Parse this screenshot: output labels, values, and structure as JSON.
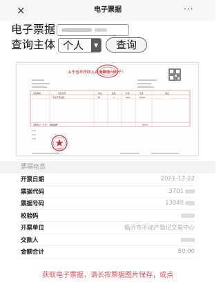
{
  "nav": {
    "close": "×",
    "title": "电子票据",
    "more": "···"
  },
  "query": {
    "receipt_label": "电子票据",
    "subject_label": "查询主体",
    "subject_value": "个人",
    "button_label": "查询"
  },
  "document": {
    "header_title": "山东省非税收入通用票据（电子）",
    "seal_text": "财政部门监制章",
    "issuer_seal_text": "专用章",
    "table_headers": [
      "项目编码",
      "项目名称",
      "单位",
      "数量",
      "标准",
      "金额",
      "备注"
    ],
    "table_row": [
      "",
      "不动产登记费",
      "件",
      "1",
      "80.0",
      "80.00",
      ""
    ],
    "total_label": "金额合计（大写）",
    "total_text": "捌拾圆整",
    "total_amount": "80.00"
  },
  "info": {
    "section_title": "票据信息",
    "rows": [
      {
        "label": "开票日期",
        "value": "2021-12-22"
      },
      {
        "label": "票据代码",
        "value": "3701"
      },
      {
        "label": "票据号码",
        "value": "13040"
      },
      {
        "label": "校验码",
        "value": ""
      },
      {
        "label": "开票单位",
        "value": "临沂市不动产登记交易中心"
      },
      {
        "label": "交款人",
        "value": ""
      },
      {
        "label": "金额合计",
        "value": "80.00"
      }
    ]
  },
  "footer": {
    "text": "获取电子票据，请长按票据图片保存，或点"
  },
  "colors": {
    "footer": "#e05050",
    "seal": "#d03030"
  }
}
